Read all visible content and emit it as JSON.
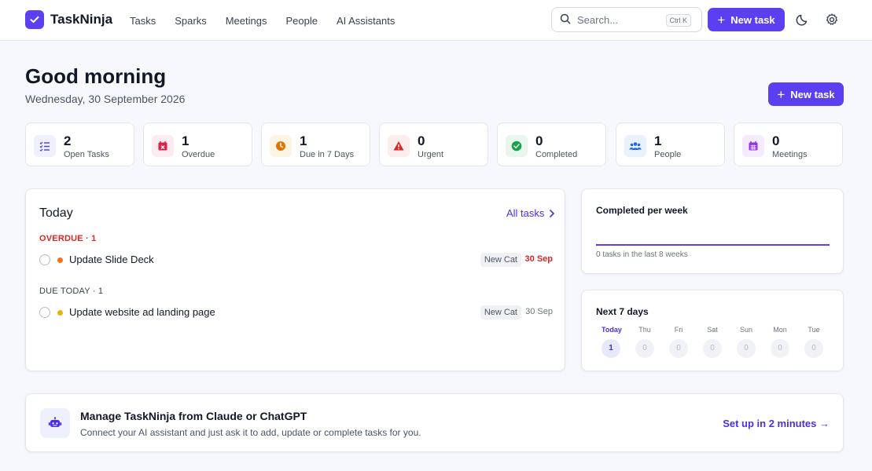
{
  "app": {
    "name": "TaskNinja",
    "logo_icon": "check-icon",
    "brand_color": "#5b3ff0"
  },
  "nav": {
    "items": [
      "Tasks",
      "Sparks",
      "Meetings",
      "People",
      "AI Assistants"
    ]
  },
  "search": {
    "placeholder": "Search...",
    "shortcut": "Ctrl K",
    "icon": "search-icon"
  },
  "header": {
    "new_task_label": "New task",
    "theme_icon": "moon-icon",
    "settings_icon": "gear-icon"
  },
  "greeting": {
    "title": "Good morning",
    "date": "Wednesday, 30 September 2026",
    "new_task_label": "New task"
  },
  "stats": [
    {
      "value": "2",
      "label": "Open Tasks",
      "icon": "list-check-icon",
      "color": "#4f46e5",
      "bg": "#eef0fe"
    },
    {
      "value": "1",
      "label": "Overdue",
      "icon": "calendar-x-icon",
      "color": "#e11d48",
      "bg": "#fdecef"
    },
    {
      "value": "1",
      "label": "Due in 7 Days",
      "icon": "clock-icon",
      "color": "#d97706",
      "bg": "#fdf3e3"
    },
    {
      "value": "0",
      "label": "Urgent",
      "icon": "warning-icon",
      "color": "#dc2626",
      "bg": "#fdecec"
    },
    {
      "value": "0",
      "label": "Completed",
      "icon": "check-circle-icon",
      "color": "#16a34a",
      "bg": "#e8f7ee"
    },
    {
      "value": "1",
      "label": "People",
      "icon": "users-icon",
      "color": "#2563eb",
      "bg": "#eaf1fe"
    },
    {
      "value": "0",
      "label": "Meetings",
      "icon": "calendar-icon",
      "color": "#9333ea",
      "bg": "#f4ebfe"
    }
  ],
  "today": {
    "title": "Today",
    "all_tasks_label": "All tasks",
    "groups": [
      {
        "label": "OVERDUE · 1",
        "color": "#dc2626",
        "tasks": [
          {
            "title": "Update Slide Deck",
            "tag": "New Cat",
            "due": "30 Sep",
            "dot_color": "#f97316",
            "due_color": "#dc2626"
          }
        ]
      },
      {
        "label": "DUE TODAY · 1",
        "color": "#374151",
        "tasks": [
          {
            "title": "Update website ad landing page",
            "tag": "New Cat",
            "due": "30 Sep",
            "dot_color": "#eab308",
            "due_color": "#6b7280"
          }
        ]
      }
    ]
  },
  "completed_week": {
    "title": "Completed per week",
    "caption": "0 tasks in the last 8 weeks"
  },
  "next_days": {
    "title": "Next 7 days",
    "days": [
      {
        "label": "Today",
        "count": "1",
        "active": true
      },
      {
        "label": "Thu",
        "count": "0",
        "active": false
      },
      {
        "label": "Fri",
        "count": "0",
        "active": false
      },
      {
        "label": "Sat",
        "count": "0",
        "active": false
      },
      {
        "label": "Sun",
        "count": "0",
        "active": false
      },
      {
        "label": "Mon",
        "count": "0",
        "active": false
      },
      {
        "label": "Tue",
        "count": "0",
        "active": false
      }
    ]
  },
  "ai_banner": {
    "title": "Manage TaskNinja from Claude or ChatGPT",
    "subtitle": "Connect your AI assistant and just ask it to add, update or complete tasks for you.",
    "link": "Set up in 2 minutes →",
    "icon": "robot-icon"
  }
}
